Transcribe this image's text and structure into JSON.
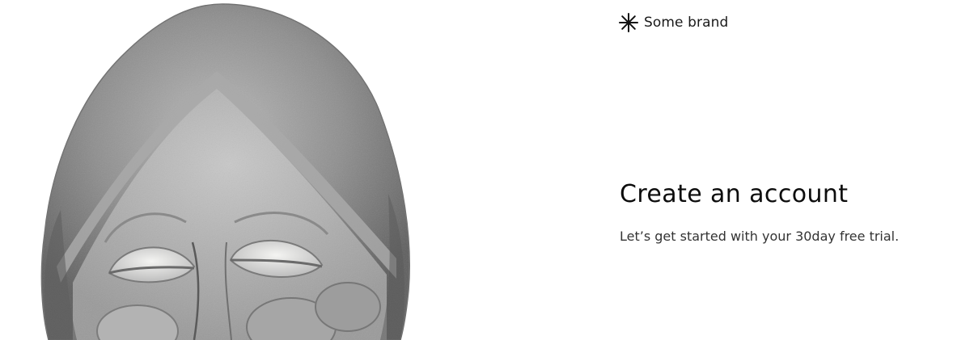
{
  "brand": {
    "logo_icon": "asterisk-icon",
    "name": "Some brand"
  },
  "main": {
    "title": "Create an account",
    "subtitle": "Let’s get started with your 30day free trial."
  },
  "hero": {
    "illustration": "watercolor-stone-face-illustration"
  },
  "colors": {
    "background": "#ffffff",
    "text": "#0d0d0d",
    "illustration_tone": "#8a8a8a"
  }
}
